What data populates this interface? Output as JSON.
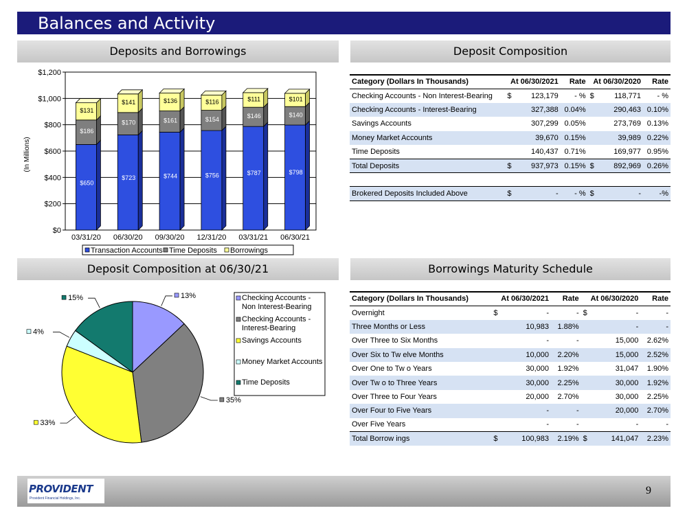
{
  "title": "Balances and Activity",
  "sections": {
    "deposits_borrowings": "Deposits and Borrowings",
    "deposit_composition": "Deposit Composition",
    "deposit_composition_date": "Deposit Composition at 06/30/21",
    "borrowings_maturity": "Borrowings Maturity Schedule"
  },
  "colors": {
    "title_bar": "#1b1b7a",
    "transaction": "#2e4fe0",
    "time_deposits": "#7f7f7f",
    "borrowings": "#ffff99",
    "pie_checking_nonint": "#9999ff",
    "pie_checking_int": "#808080",
    "pie_savings": "#ffff33",
    "pie_money_market": "#ccffff",
    "pie_time": "#137a6e",
    "table_shade": "#d6e2f3"
  },
  "chart_data": [
    {
      "type": "bar",
      "stacked": true,
      "title": "Deposits and Borrowings",
      "ylabel": "(In Millions)",
      "ylim": [
        0,
        1200
      ],
      "yticks": [
        "$0",
        "$200",
        "$400",
        "$600",
        "$800",
        "$1,000",
        "$1,200"
      ],
      "categories": [
        "03/31/20",
        "06/30/20",
        "09/30/20",
        "12/31/20",
        "03/31/21",
        "06/30/21"
      ],
      "series": [
        {
          "name": "Transaction Accounts",
          "values": [
            650,
            723,
            744,
            756,
            787,
            798
          ],
          "labels": [
            "$650",
            "$723",
            "$744",
            "$756",
            "$787",
            "$798"
          ]
        },
        {
          "name": "Time Deposits",
          "values": [
            186,
            170,
            161,
            154,
            146,
            140
          ],
          "labels": [
            "$186",
            "$170",
            "$161",
            "$154",
            "$146",
            "$140"
          ]
        },
        {
          "name": "Borrowings",
          "values": [
            131,
            141,
            136,
            116,
            111,
            101
          ],
          "labels": [
            "$131",
            "$141",
            "$136",
            "$116",
            "$111",
            "$101"
          ]
        }
      ],
      "grid": true,
      "legend": "bottom"
    },
    {
      "type": "pie",
      "title": "Deposit Composition at 06/30/21",
      "slices": [
        {
          "name": "Checking Accounts - Non Interest-Bearing",
          "legend": [
            "Checking Accounts -",
            "Non Interest-Bearing"
          ],
          "value": 13,
          "label": "13%"
        },
        {
          "name": "Checking Accounts - Interest-Bearing",
          "legend": [
            "Checking Accounts -",
            "Interest-Bearing"
          ],
          "value": 35,
          "label": "35%"
        },
        {
          "name": "Savings Accounts",
          "legend": [
            "Savings Accounts"
          ],
          "value": 33,
          "label": "33%"
        },
        {
          "name": "Money Market Accounts",
          "legend": [
            "Money Market Accounts"
          ],
          "value": 4,
          "label": "4%"
        },
        {
          "name": "Time Deposits",
          "legend": [
            "Time Deposits"
          ],
          "value": 15,
          "label": "15%"
        }
      ],
      "legend": "right"
    }
  ],
  "deposit_table": {
    "headers": [
      "Category (Dollars In Thousands)",
      "At 06/30/2021",
      "Rate",
      "At 06/30/2020",
      "Rate"
    ],
    "rows": [
      {
        "category": "Checking Accounts - Non Interest-Bearing",
        "cur1": "$",
        "val1": "123,179",
        "rate1": "- %",
        "cur2": "$",
        "val2": "118,771",
        "rate2": "- %"
      },
      {
        "category": "Checking Accounts - Interest-Bearing",
        "cur1": "",
        "val1": "327,388",
        "rate1": "0.04%",
        "cur2": "",
        "val2": "290,463",
        "rate2": "0.10%"
      },
      {
        "category": "Savings Accounts",
        "cur1": "",
        "val1": "307,299",
        "rate1": "0.05%",
        "cur2": "",
        "val2": "273,769",
        "rate2": "0.13%"
      },
      {
        "category": "Money Market Accounts",
        "cur1": "",
        "val1": "39,670",
        "rate1": "0.15%",
        "cur2": "",
        "val2": "39,989",
        "rate2": "0.22%"
      },
      {
        "category": "Time Deposits",
        "cur1": "",
        "val1": "140,437",
        "rate1": "0.71%",
        "cur2": "",
        "val2": "169,977",
        "rate2": "0.95%"
      },
      {
        "category": "Total Deposits",
        "cur1": "$",
        "val1": "937,973",
        "rate1": "0.15%",
        "cur2": "$",
        "val2": "892,969",
        "rate2": "0.26%"
      }
    ],
    "brokered": {
      "category": "Brokered Deposits Included Above",
      "cur1": "$",
      "val1": "-",
      "rate1": "- %",
      "cur2": "$",
      "val2": "-",
      "rate2": "-%"
    }
  },
  "borrowings_table": {
    "headers": [
      "Category (Dollars In Thousands)",
      "At 06/30/2021",
      "Rate",
      "At 06/30/2020",
      "Rate"
    ],
    "rows": [
      {
        "category": "Overnight",
        "cur1": "$",
        "val1": "-",
        "rate1": "-",
        "cur2": "$",
        "val2": "-",
        "rate2": "-"
      },
      {
        "category": "Three Months or Less",
        "cur1": "",
        "val1": "10,983",
        "rate1": "1.88%",
        "cur2": "",
        "val2": "-",
        "rate2": "-"
      },
      {
        "category": "Over Three to Six Months",
        "cur1": "",
        "val1": "-",
        "rate1": "-",
        "cur2": "",
        "val2": "15,000",
        "rate2": "2.62%"
      },
      {
        "category": "Over Six to Tw elve Months",
        "cur1": "",
        "val1": "10,000",
        "rate1": "2.20%",
        "cur2": "",
        "val2": "15,000",
        "rate2": "2.52%"
      },
      {
        "category": "Over One to Tw o Years",
        "cur1": "",
        "val1": "30,000",
        "rate1": "1.92%",
        "cur2": "",
        "val2": "31,047",
        "rate2": "1.90%"
      },
      {
        "category": "Over Tw o to Three Years",
        "cur1": "",
        "val1": "30,000",
        "rate1": "2.25%",
        "cur2": "",
        "val2": "30,000",
        "rate2": "1.92%"
      },
      {
        "category": "Over Three to Four Years",
        "cur1": "",
        "val1": "20,000",
        "rate1": "2.70%",
        "cur2": "",
        "val2": "30,000",
        "rate2": "2.25%"
      },
      {
        "category": "Over Four to Five Years",
        "cur1": "",
        "val1": "-",
        "rate1": "-",
        "cur2": "",
        "val2": "20,000",
        "rate2": "2.70%"
      },
      {
        "category": "Over Five Years",
        "cur1": "",
        "val1": "-",
        "rate1": "-",
        "cur2": "",
        "val2": "-",
        "rate2": "-"
      },
      {
        "category": "Total Borrow ings",
        "cur1": "$",
        "val1": "100,983",
        "rate1": "2.19%",
        "cur2": "$",
        "val2": "141,047",
        "rate2": "2.23%"
      }
    ]
  },
  "footer": {
    "logo_text": "PROVIDENT",
    "logo_subtext": "Provident Financial Holdings, Inc.",
    "page_number": "9"
  }
}
